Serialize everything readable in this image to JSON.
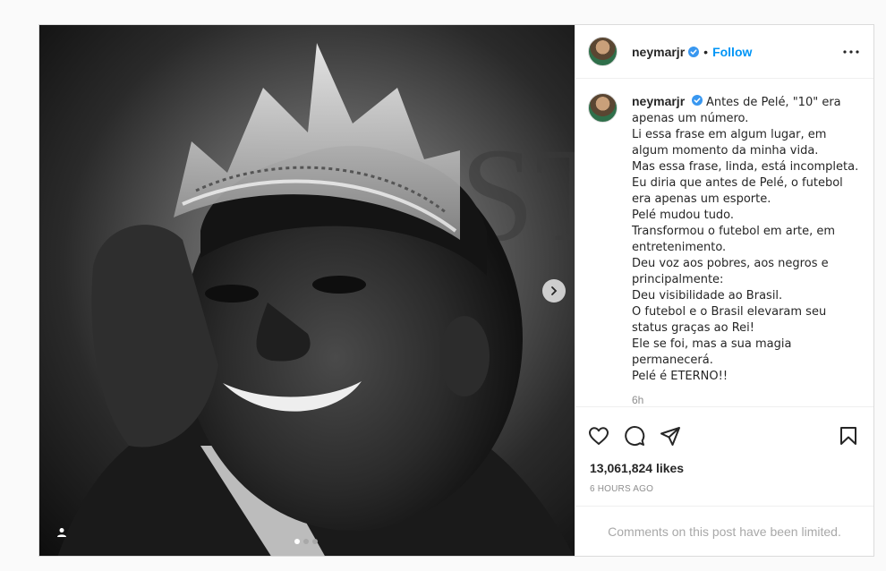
{
  "post": {
    "username": "neymarjr",
    "follow_label": "Follow",
    "separator": "•",
    "caption_lines": [
      "Antes de Pelé, \"10\" era",
      "apenas um número.",
      "Li essa frase em algum lugar, em",
      "algum momento da minha vida.",
      "Mas essa frase, linda, está incompleta.",
      "Eu diria que antes de Pelé, o futebol",
      "era apenas um esporte.",
      "Pelé mudou tudo.",
      "Transformou o futebol em arte, em",
      "entretenimento.",
      "Deu voz aos pobres, aos negros e",
      "principalmente:",
      "Deu visibilidade ao Brasil.",
      "O futebol e o Brasil elevaram seu",
      "status graças ao Rei!",
      "Ele se foi, mas a sua magia",
      "permanecerá.",
      "Pelé é ETERNO!!"
    ],
    "caption_time": "6h",
    "likes": "13,061,824 likes",
    "posted_ago": "6 HOURS AGO",
    "comments_notice": "Comments on this post have been limited.",
    "carousel": {
      "total": 3,
      "current": 1
    }
  },
  "icons": {
    "verified": "verified-badge-icon",
    "more": "more-options-icon",
    "like": "heart-icon",
    "comment": "comment-icon",
    "share": "send-icon",
    "save": "bookmark-icon",
    "next": "chevron-right-icon",
    "tags": "user-tag-icon"
  },
  "colors": {
    "accent": "#0095f6",
    "verified": "#3897f0",
    "muted": "#8e8e8e"
  }
}
